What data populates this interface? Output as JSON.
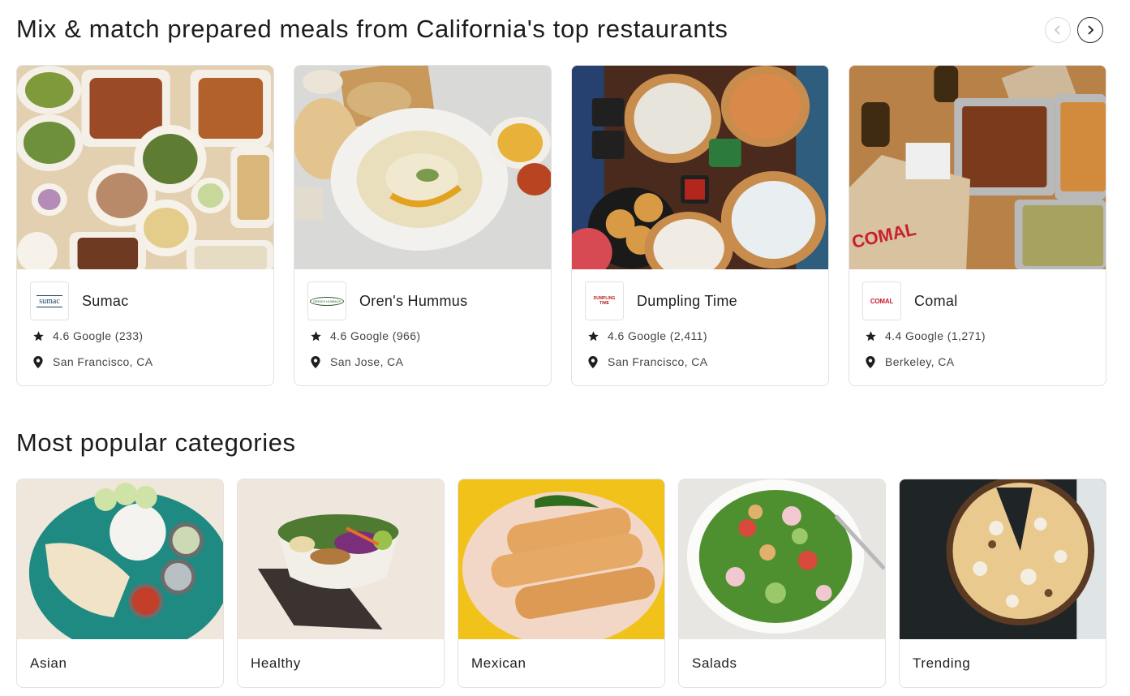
{
  "sections": {
    "restaurants_title": "Mix & match prepared meals from California's top restaurants",
    "categories_title": "Most popular categories"
  },
  "restaurants": [
    {
      "name": "Sumac",
      "rating": "4.6 Google (233)",
      "location": "San Francisco, CA",
      "logo_text": "sumac"
    },
    {
      "name": "Oren's Hummus",
      "rating": "4.6 Google (966)",
      "location": "San Jose, CA",
      "logo_text": "OREN'S HUMMUS"
    },
    {
      "name": "Dumpling Time",
      "rating": "4.6 Google (2,411)",
      "location": "San Francisco, CA",
      "logo_text": "DUMPLING TIME"
    },
    {
      "name": "Comal",
      "rating": "4.4 Google (1,271)",
      "location": "Berkeley, CA",
      "logo_text": "COMAL"
    }
  ],
  "categories": [
    {
      "label": "Asian"
    },
    {
      "label": "Healthy"
    },
    {
      "label": "Mexican"
    },
    {
      "label": "Salads"
    },
    {
      "label": "Trending"
    }
  ],
  "icons": {
    "prev": "chevron-left-icon",
    "next": "chevron-right-icon",
    "rating": "star-icon",
    "location": "map-pin-icon"
  },
  "colors": {
    "text": "#1f1f1f",
    "border": "#e2e2e2",
    "comal_red": "#c8202f"
  }
}
